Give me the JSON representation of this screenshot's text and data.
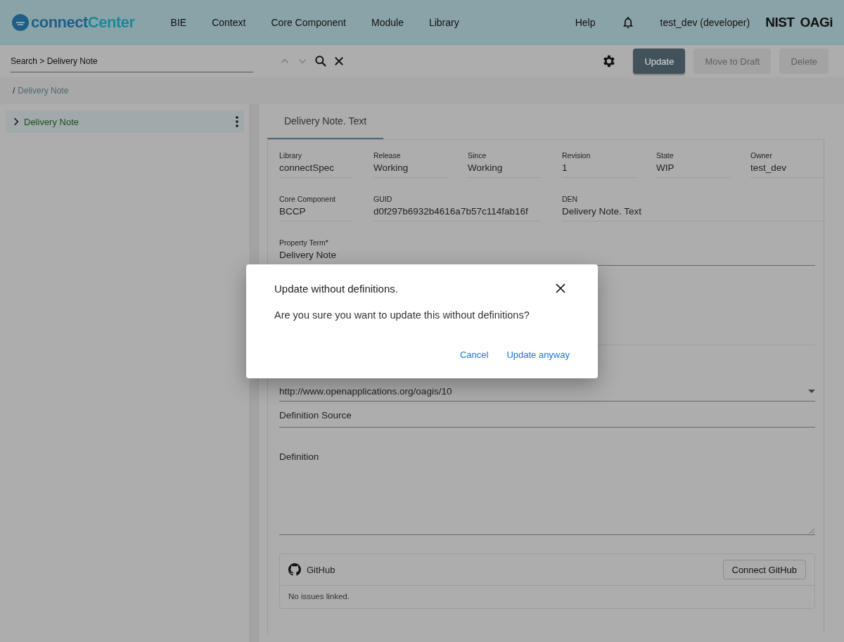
{
  "header": {
    "logo": [
      "connect",
      "Center"
    ],
    "nav": [
      "BIE",
      "Context",
      "Core Component",
      "Module",
      "Library"
    ],
    "help": "Help",
    "user": "test_dev (developer)",
    "brand": [
      "NIST",
      "OAGi"
    ]
  },
  "toolbar": {
    "search": {
      "value": "Search > Delivery Note"
    },
    "buttons": [
      {
        "label": "Update",
        "disabled": false
      },
      {
        "label": "Move to Draft",
        "disabled": true
      },
      {
        "label": "Delete",
        "disabled": true
      }
    ]
  },
  "breadcrumb": {
    "separator": "/",
    "link": "Delivery Note"
  },
  "tree": [
    {
      "label": "Delivery Note",
      "expanded": false,
      "selected": true
    }
  ],
  "tabs": [
    {
      "label": "Delivery Note. Text",
      "selected": true
    }
  ],
  "form": {
    "info": [
      {
        "label": "Library",
        "value": "connectSpec"
      },
      {
        "label": "Release",
        "value": "Working"
      },
      {
        "label": "Since",
        "value": "Working"
      },
      {
        "label": "Revision",
        "value": "1"
      },
      {
        "label": "State",
        "value": "WIP"
      },
      {
        "label": "Owner",
        "value": "test_dev"
      },
      {
        "label": "Core Component",
        "value": "BCCP"
      },
      {
        "label": "GUID",
        "value": "d0f297b6932b4616a7b57c114fab16f"
      },
      {
        "label": "DEN",
        "value": "Delivery Note. Text"
      }
    ],
    "fields": [
      {
        "kind": "text",
        "label": "Property Term*",
        "value": "Delivery Note"
      },
      {
        "kind": "select",
        "value": "http://www.openapplications.org/oagis/10"
      },
      {
        "kind": "text",
        "placeholder": "Definition Source"
      },
      {
        "kind": "textarea",
        "placeholder": "Definition"
      }
    ]
  },
  "github": {
    "title": "GitHub",
    "button": "Connect GitHub",
    "message": "No issues linked."
  },
  "dialog": {
    "title": "Update without definitions.",
    "message": "Are you sure you want to update this without definitions?",
    "buttons": [
      "Cancel",
      "Update anyway"
    ]
  }
}
